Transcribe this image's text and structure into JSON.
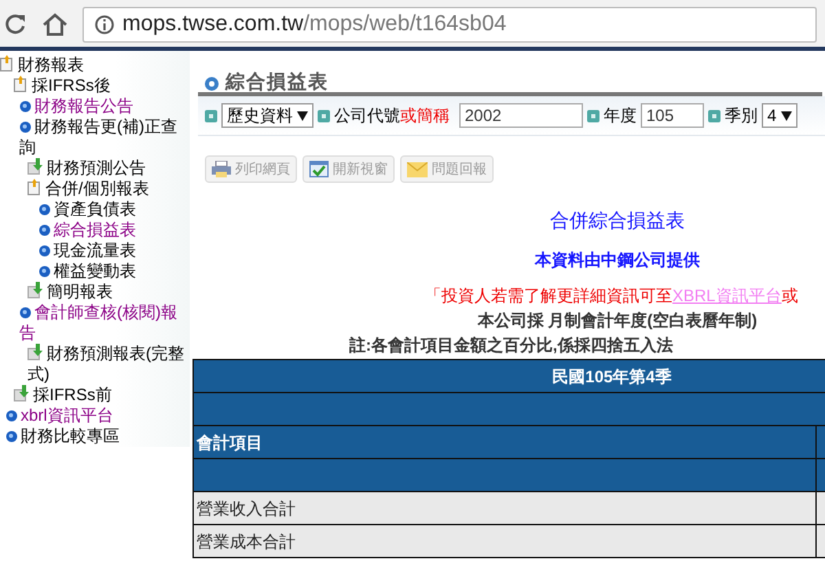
{
  "browser": {
    "url_host": "mops.twse.com.tw",
    "url_path": "/mops/web/t164sb04"
  },
  "sidebar": {
    "items": [
      {
        "label": "財務報表",
        "kind": "folder",
        "children": [
          {
            "label": "採IFRSs後",
            "kind": "folder",
            "children": [
              {
                "label": "財務報告公告",
                "kind": "link",
                "visited": true
              },
              {
                "label": "財務報告更(補)正查詢",
                "kind": "link",
                "visited": false
              },
              {
                "label": "財務預測公告",
                "kind": "leaf"
              },
              {
                "label": "合併/個別報表",
                "kind": "folder",
                "children": [
                  {
                    "label": "資產負債表",
                    "kind": "link",
                    "visited": false
                  },
                  {
                    "label": "綜合損益表",
                    "kind": "link",
                    "visited": true
                  },
                  {
                    "label": "現金流量表",
                    "kind": "link",
                    "visited": false
                  },
                  {
                    "label": "權益變動表",
                    "kind": "link",
                    "visited": false
                  }
                ]
              },
              {
                "label": "簡明報表",
                "kind": "leaf"
              },
              {
                "label": "會計師查核(核閱)報告",
                "kind": "link",
                "visited": true
              },
              {
                "label": "財務預測報表(完整式)",
                "kind": "leaf"
              }
            ]
          },
          {
            "label": "採IFRSs前",
            "kind": "leaf"
          },
          {
            "label": "xbrl資訊平台",
            "kind": "link",
            "visited": true
          },
          {
            "label": "財務比較專區",
            "kind": "link",
            "visited": false
          }
        ]
      }
    ]
  },
  "page_title": "綜合損益表",
  "filters": {
    "source": "歷史資料",
    "company_label": "公司代號",
    "company_label_alt": "或簡稱",
    "company": "2002",
    "year_label": "年度",
    "year": "105",
    "season_label": "季別",
    "season": "4"
  },
  "tools": [
    {
      "label": "列印網頁",
      "kind": "print"
    },
    {
      "label": "開新視窗",
      "kind": "window"
    },
    {
      "label": "問題回報",
      "kind": "mail"
    }
  ],
  "report": {
    "title": "合併綜合損益表",
    "provider": "本資料由中鋼公司提供",
    "notice": "「投資人若需了解更詳細資訊可至",
    "notice_link": "XBRL資訊平台",
    "notice_tail": "或",
    "fiscal_note": "本公司採 月制會計年度(空白表曆年制)",
    "rounding_note": "註:各會計項目金額之百分比,係採四捨五入法"
  },
  "table": {
    "period": "民國105年第4季",
    "column_1": "會計項目",
    "rows": [
      "營業收入合計",
      "營業成本合計"
    ]
  }
}
